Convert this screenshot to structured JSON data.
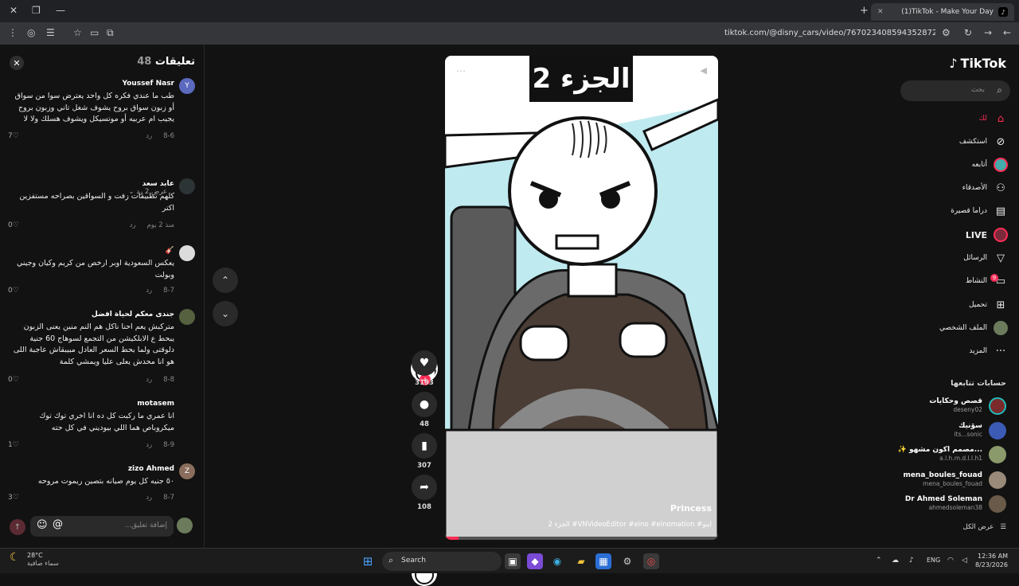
{
  "browser": {
    "tab_title": "(1)TikTok - Make Your Day",
    "url": "tiktok.com/@disny_cars/video/7670234085943528722"
  },
  "comments_panel": {
    "title": "تعليقات",
    "count": "48",
    "items": [
      {
        "name": "Youssef Nasr",
        "avatar_letter": "Y",
        "avatar_color": "#5b6abf",
        "text": "طب ما عندي فكره كل واحد يعترض سوا من سواق أو زبون سواق بروح يشوف شغل تاني وزبون بروح يجيب ام عربيه أو موتسيكل ويشوف هسلك ولا لا",
        "date": "8-6",
        "reply": "رد",
        "likes": "7"
      },
      {
        "name": "عابد سعد",
        "avatar_letter": "",
        "avatar_color": "#2d3436",
        "text": "كلهم تطبيقات زفت و السواقين بصراحه مستفزين اكتر",
        "date": "منذ 2 يوم",
        "reply": "رد",
        "likes": "0"
      },
      {
        "name": "🎸",
        "avatar_letter": "",
        "avatar_color": "#dcdcdc",
        "text": "يعكس السعودية اوبر ارخص من كريم وكيان وجيني وبولت",
        "date": "8-7",
        "reply": "رد",
        "likes": "0"
      },
      {
        "name": "جندى معكم لحياة افضل",
        "avatar_letter": "",
        "avatar_color": "#55613f",
        "text": "متركبش يعم احنا ناكل هم النم منين يعنى الزبون يبحط ع الابلكيشن من التجمع لسوهاج 60 جنية دلوقتى ولما بحط السعر العادل مبيبقاش عاجبة اللى هو انا محدش يعلى عليا ويمشي كلمة",
        "date": "8-8",
        "reply": "رد",
        "likes": "0"
      },
      {
        "name": "motasem",
        "avatar_letter": "",
        "avatar_color": "",
        "text": "انا عمري ما ركبت كل ده انا اخري توك توك ميكروباص هما اللي بيوديني في كل حته",
        "date": "8-9",
        "reply": "رد",
        "likes": "1"
      },
      {
        "name": "zizo Ahmed",
        "avatar_letter": "Z",
        "avatar_color": "#8a6d5c",
        "text": "٥٠ جنيه كل يوم صيانه بتصين ريموت مروحه",
        "date": "8-7",
        "reply": "رد",
        "likes": "3"
      }
    ],
    "view_replies": "عرض 2 رد",
    "input_placeholder": "إضافة تعليق..."
  },
  "video": {
    "overlay_title": "الجزء 2",
    "author": "Princess",
    "caption": "الجزء 2 #VNVideoEditor #eino #einomation #اينو",
    "progress": 0.05
  },
  "actions": {
    "likes": "3193",
    "comments": "48",
    "saves": "307",
    "shares": "108"
  },
  "sidebar": {
    "logo": "TikTok",
    "search_placeholder": "بحث",
    "nav": [
      {
        "label": "لك",
        "icon": "home-icon",
        "active": true
      },
      {
        "label": "استكشف",
        "icon": "compass-icon"
      },
      {
        "label": "أتابعه",
        "icon": "following-avatar"
      },
      {
        "label": "الأصدقاء",
        "icon": "friends-icon"
      },
      {
        "label": "دراما قصيرة",
        "icon": "film-icon"
      },
      {
        "label": "LIVE",
        "icon": "live-icon"
      },
      {
        "label": "الرسائل",
        "icon": "send-icon"
      },
      {
        "label": "النشاط",
        "icon": "inbox-icon",
        "badge": "9"
      },
      {
        "label": "تحميل",
        "icon": "upload-icon"
      },
      {
        "label": "الملف الشخصي",
        "icon": "profile-avatar"
      },
      {
        "label": "المزيد",
        "icon": "more-icon"
      }
    ],
    "following_title": "حسابات تتابعها",
    "following": [
      {
        "name": "قصص وحكايات",
        "user": "deseny02",
        "color": "#7a2a2a"
      },
      {
        "name": "سۆنيك",
        "user": "its...sonic",
        "color": "#3b5bb5"
      },
      {
        "name": "✨ مصمم اكون مشهو...",
        "user": "a.l.h.m.d.l.l.h1",
        "color": "#8a9a6a"
      },
      {
        "name": "mena_boules_fouad",
        "user": "mena_boules_fouad",
        "color": "#9a8a7a"
      },
      {
        "name": "Dr Ahmed Soleman",
        "user": "ahmedsoleman38",
        "color": "#6a5a4a"
      }
    ],
    "see_all": "عرض الكل"
  },
  "taskbar": {
    "temp": "28°C",
    "weather": "سماء صافية",
    "search": "Search",
    "lang": "ENG",
    "time": "12:36 AM",
    "date": "8/23/2026"
  }
}
